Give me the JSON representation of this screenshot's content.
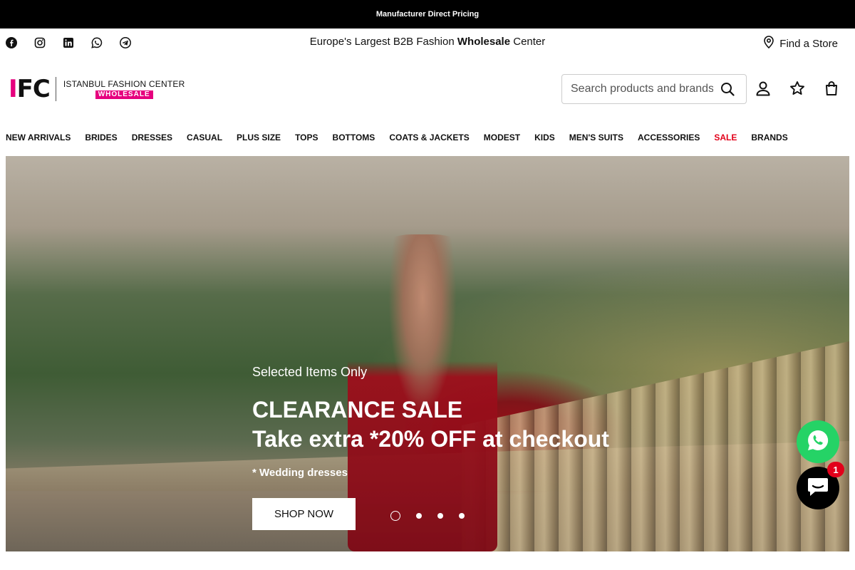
{
  "announcement": "Manufacturer Direct Pricing",
  "utility": {
    "socials": [
      "facebook-icon",
      "instagram-icon",
      "linkedin-icon",
      "whatsapp-icon",
      "telegram-icon"
    ],
    "tagline_pre": "Europe's Largest B2B Fashion ",
    "tagline_bold": "Wholesale",
    "tagline_post": " Center",
    "find_store": "Find a Store"
  },
  "logo": {
    "mark_i": "I",
    "mark_rest": "FC",
    "name": "ISTANBUL FASHION CENTER",
    "tag": "WHOLESALE"
  },
  "search": {
    "placeholder": "Search products and brands"
  },
  "nav": {
    "items": [
      "NEW ARRIVALS",
      "BRIDES",
      "DRESSES",
      "CASUAL",
      "PLUS SIZE",
      "TOPS",
      "BOTTOMS",
      "COATS & JACKETS",
      "MODEST",
      "KIDS",
      "MEN'S SUITS",
      "ACCESSORIES",
      "SALE",
      "BRANDS"
    ]
  },
  "hero": {
    "eyebrow": "Selected Items Only",
    "line1": "CLEARANCE SALE",
    "line2_pre": "Take extra *",
    "line2_em": "20% OFF",
    "line2_post": " at checkout",
    "note": "* Wedding dresses",
    "cta": "SHOP NOW",
    "slides": 4,
    "active_slide": 1
  },
  "chat": {
    "badge": "1"
  },
  "colors": {
    "accent": "#e6007e",
    "sale": "#e2001a",
    "whatsapp": "#25d366"
  }
}
